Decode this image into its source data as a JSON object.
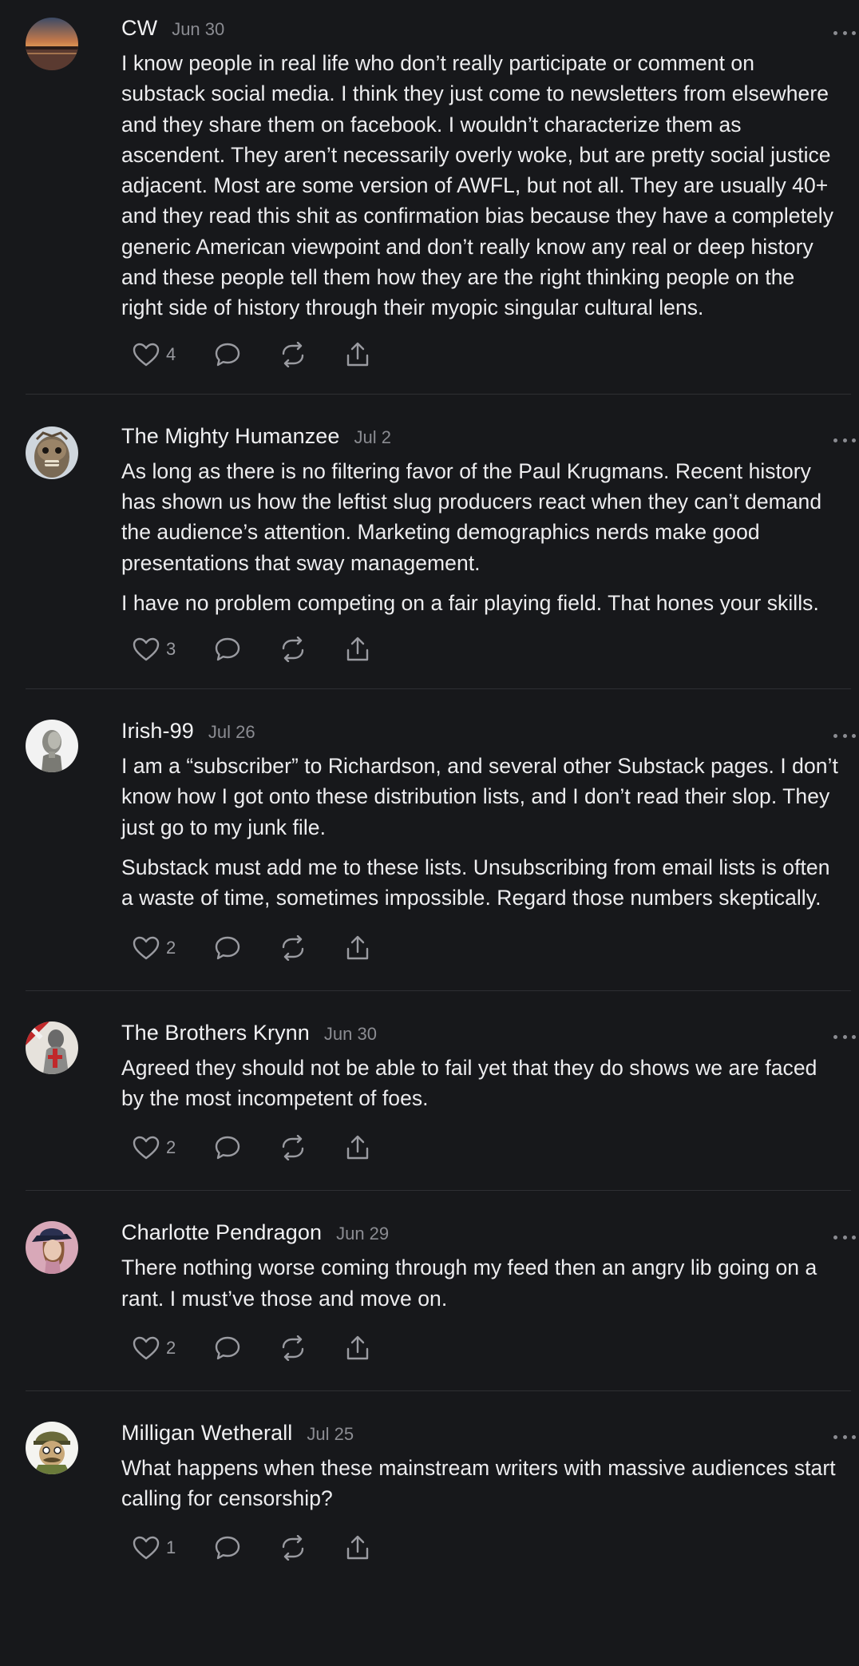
{
  "comments": [
    {
      "author": "CW",
      "date": "Jun 30",
      "avatar": "sunset-lake-avatar",
      "paragraphs": [
        "I know people in real life who don’t really participate or comment on substack social media. I think they just come to newsletters from elsewhere and they share them on facebook. I wouldn’t characterize them as ascendent. They aren’t necessarily overly woke, but are pretty social justice adjacent. Most are some version of AWFL, but not all. They are usually 40+ and they read this shit as confirmation bias because they have a completely generic American viewpoint and don’t really know any real or deep history and these people tell them how they are the right thinking people on the right side of history through their myopic singular cultural lens."
      ],
      "likes": "4"
    },
    {
      "author": "The Mighty Humanzee",
      "date": "Jul 2",
      "avatar": "mask-avatar",
      "paragraphs": [
        "As long as there is no filtering favor of the Paul Krugmans. Recent history has shown us how the leftist slug producers react when they can’t demand the audience’s attention. Marketing demographics nerds make good presentations that sway management.",
        "I have no problem competing on a fair playing field. That hones your skills."
      ],
      "likes": "3"
    },
    {
      "author": "Irish-99",
      "date": "Jul 26",
      "avatar": "bust-avatar",
      "paragraphs": [
        "I am a “subscriber” to Richardson, and several other Substack pages. I don’t know how I got onto these distribution lists, and I don’t read their slop. They just go to my junk file.",
        "Substack must add me to these lists. Unsubscribing from email lists is often a waste of time, sometimes impossible. Regard those numbers skeptically."
      ],
      "likes": "2"
    },
    {
      "author": "The Brothers Krynn",
      "date": "Jun 30",
      "avatar": "knight-avatar",
      "paragraphs": [
        "Agreed they should not be able to fail yet that they do shows we are faced by the most incompetent of foes."
      ],
      "likes": "2"
    },
    {
      "author": "Charlotte Pendragon",
      "date": "Jun 29",
      "avatar": "portrait-avatar",
      "paragraphs": [
        "There nothing worse coming through my feed then an angry lib going on a rant. I must’ve those and move on."
      ],
      "likes": "2"
    },
    {
      "author": "Milligan Wetherall",
      "date": "Jul 25",
      "avatar": "cartoon-avatar",
      "paragraphs": [
        "What happens when these mainstream writers with massive audiences start calling for censorship?"
      ],
      "likes": "1"
    }
  ]
}
